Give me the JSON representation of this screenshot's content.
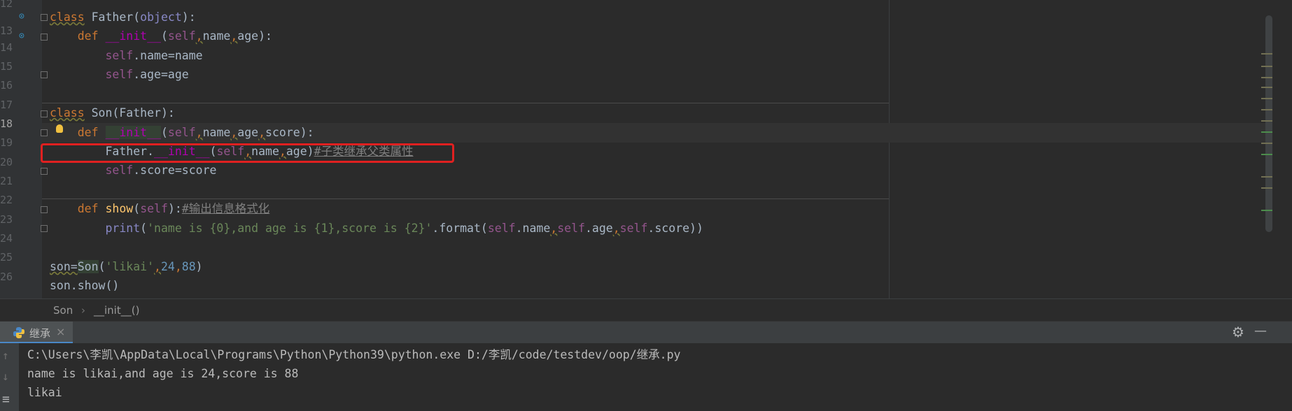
{
  "editor": {
    "line_numbers": [
      "12",
      "13",
      "14",
      "15",
      "16",
      "17",
      "18",
      "19",
      "20",
      "21",
      "22",
      "23",
      "24",
      "25",
      "26"
    ],
    "code": {
      "l12": {
        "kw": "class",
        "name": "Father",
        "p1": "(",
        "base": "object",
        "p2": "):"
      },
      "l13": {
        "kw": "def",
        "name": "__init__",
        "p1": "(",
        "self": "self",
        "c1": ",",
        "a1": "name",
        "c2": ",",
        "a2": "age",
        "p2": "):"
      },
      "l14": {
        "self": "self",
        "rest": ".name=name"
      },
      "l15": {
        "self": "self",
        "rest": ".age=age"
      },
      "l17": {
        "kw": "class",
        "name": "Son",
        "rest": "(Father):"
      },
      "l18": {
        "kw": "def",
        "name": "__init__",
        "p1": "(",
        "self": "self",
        "c1": ",",
        "a1": "name",
        "c2": ",",
        "a2": "age",
        "c3": ",",
        "a3": "score",
        "p2": "):"
      },
      "l19": {
        "cls": "Father.",
        "name": "__init__",
        "p1": "(",
        "self": "self",
        "c1": ",",
        "a1": "name",
        "c2": ",",
        "a2": "age",
        "p2": ")",
        "comment": "#子类继承父类属性"
      },
      "l20": {
        "self": "self",
        "rest": ".score=score"
      },
      "l22": {
        "kw": "def",
        "name": "show",
        "p1": "(",
        "self": "self",
        "p2": "):",
        "comment": "#输出信息格式化"
      },
      "l23": {
        "fn": "print",
        "p1": "(",
        "str": "'name is {0},and age is {1},score is {2}'",
        "mid": ".format(",
        "self1": "self",
        "r1": ".name",
        "c1": ",",
        "self2": "self",
        "r2": ".age",
        "c2": ",",
        "self3": "self",
        "r3": ".score",
        "p2": "))"
      },
      "l25": {
        "var": "son=",
        "cls": "Son",
        "p1": "(",
        "str": "'likai'",
        "c1": ",",
        "n1": "24",
        "c2": ",",
        "n2": "88",
        "p2": ")"
      },
      "l26": {
        "text": "son.show()"
      }
    }
  },
  "breadcrumb": {
    "item1": "Son",
    "sep": "›",
    "item2": "__init__()"
  },
  "run_panel": {
    "tab_label": "继承",
    "close_glyph": "×",
    "settings_icon": "gear-icon",
    "minimize_icon": "minimize-icon",
    "gear_glyph": "⚙",
    "minimize_glyph": "—",
    "up_glyph": "↑",
    "down_glyph": "↓",
    "wrap_glyph": "≡"
  },
  "console": {
    "lines": [
      "C:\\Users\\李凯\\AppData\\Local\\Programs\\Python\\Python39\\python.exe D:/李凯/code/testdev/oop/继承.py",
      "name is likai,and age is 24,score is 88",
      "likai"
    ]
  },
  "colors": {
    "accent": "#4a88c7",
    "highlight_box": "#e02020",
    "background": "#2b2b2b"
  }
}
